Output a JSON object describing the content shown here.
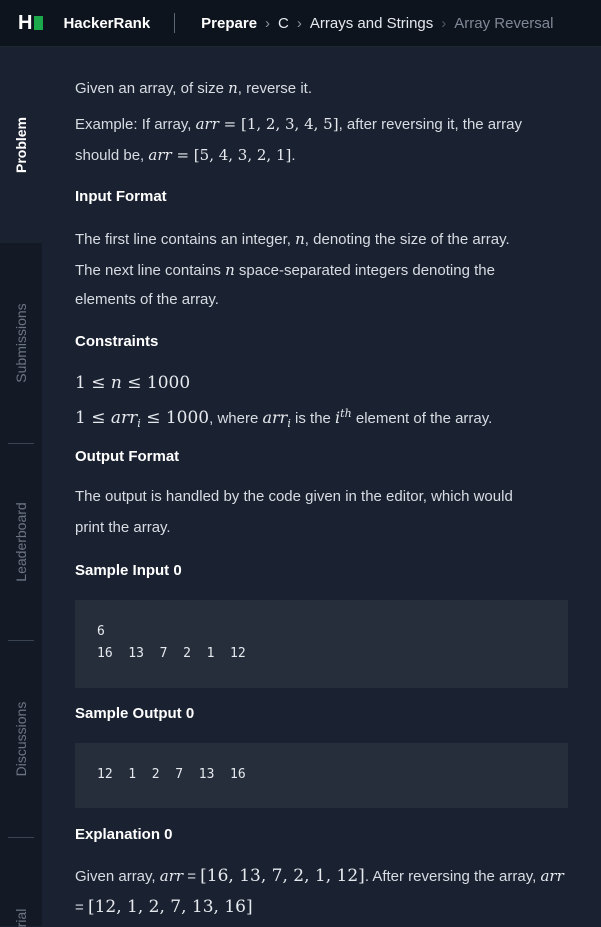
{
  "topbar": {
    "brand": "HackerRank",
    "breadcrumb": {
      "prepare": "Prepare",
      "language": "C",
      "section": "Arrays and Strings",
      "current": "Array Reversal"
    }
  },
  "sidetabs": [
    "Problem",
    "Submissions",
    "Leaderboard",
    "Discussions",
    "rial"
  ],
  "problem": {
    "intro": "Given an array, of size ",
    "intro_var": "n",
    "intro_end": ", reverse it.",
    "example_prefix": "Example: If array, ",
    "example_arr1": "arr",
    "example_eq1": " = [1, 2, 3, 4, 5]",
    "example_mid": ", after reversing it, the array",
    "example_line2_prefix": "should be, ",
    "example_arr2": "arr",
    "example_eq2": " = [5, 4, 3, 2, 1]",
    "example_end": ".",
    "input_format_heading": "Input Format",
    "input_line1_a": "The first line contains an integer, ",
    "input_line1_var": "n",
    "input_line1_b": ", denoting the size of the array.",
    "input_line2_a": "The next line contains ",
    "input_line2_var": "n",
    "input_line2_b": " space-separated integers denoting the",
    "input_line3": "elements of the array.",
    "constraints_heading": "Constraints",
    "constraint1_a": "1 ≤ ",
    "constraint1_var": "n",
    "constraint1_b": " ≤ 1000",
    "constraint2_a": "1 ≤ ",
    "constraint2_var": "arr",
    "constraint2_sub": "i",
    "constraint2_b": " ≤ 1000",
    "constraint2_c": ", where ",
    "constraint2_var2": "arr",
    "constraint2_sub2": "i",
    "constraint2_d": " is the ",
    "constraint2_i": "i",
    "constraint2_th": "th",
    "constraint2_e": " element of the array.",
    "output_format_heading": "Output Format",
    "output_line1": "The output is handled by the code given in the editor, which would",
    "output_line2": "print the array.",
    "sample_input_heading": "Sample Input 0",
    "sample_input_line1": "6",
    "sample_input_line2": "16  13  7  2  1  12",
    "sample_output_heading": "Sample Output 0",
    "sample_output_line1": "12  1  2  7  13  16",
    "explanation_heading": "Explanation 0",
    "expl_a": "Given array, ",
    "expl_var1": "arr",
    "expl_b": " = ",
    "expl_arr1": "[16, 13, 7, 2, 1, 12]",
    "expl_c": ". After reversing the array, ",
    "expl_var2": "arr",
    "expl_d": "= ",
    "expl_arr2": "[12, 1, 2, 7, 13, 16]"
  },
  "colors": {
    "background": "#1a2130",
    "topbar": "#0e141e",
    "brand_green": "#1ba94c",
    "codebox": "#262e3b"
  }
}
